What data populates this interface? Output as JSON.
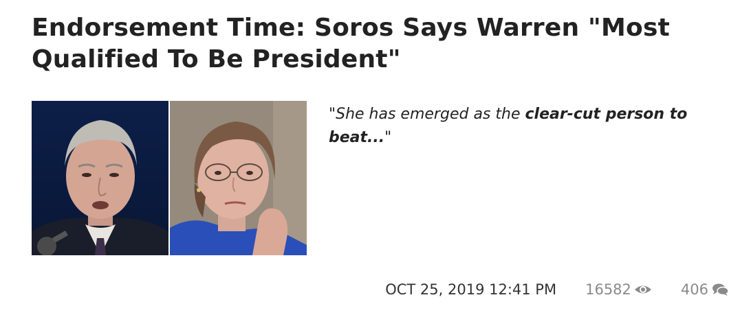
{
  "article": {
    "headline": "Endorsement Time: Soros Says Warren \"Most Qualified To Be President\"",
    "teaser": {
      "quote_start": "\"She has emerged as the ",
      "quote_bold": "clear-cut person to beat...",
      "quote_end": "\""
    },
    "meta": {
      "timestamp": "OCT 25, 2019 12:41 PM",
      "views": "16582",
      "views_icon": "eye-icon",
      "comments": "406",
      "comments_icon": "comment-icon"
    }
  },
  "colors": {
    "text": "#222222",
    "meta_muted": "#8a8a8a",
    "left_photo_bg": "#0d1f48",
    "right_photo_bg": "#8a7f70"
  }
}
